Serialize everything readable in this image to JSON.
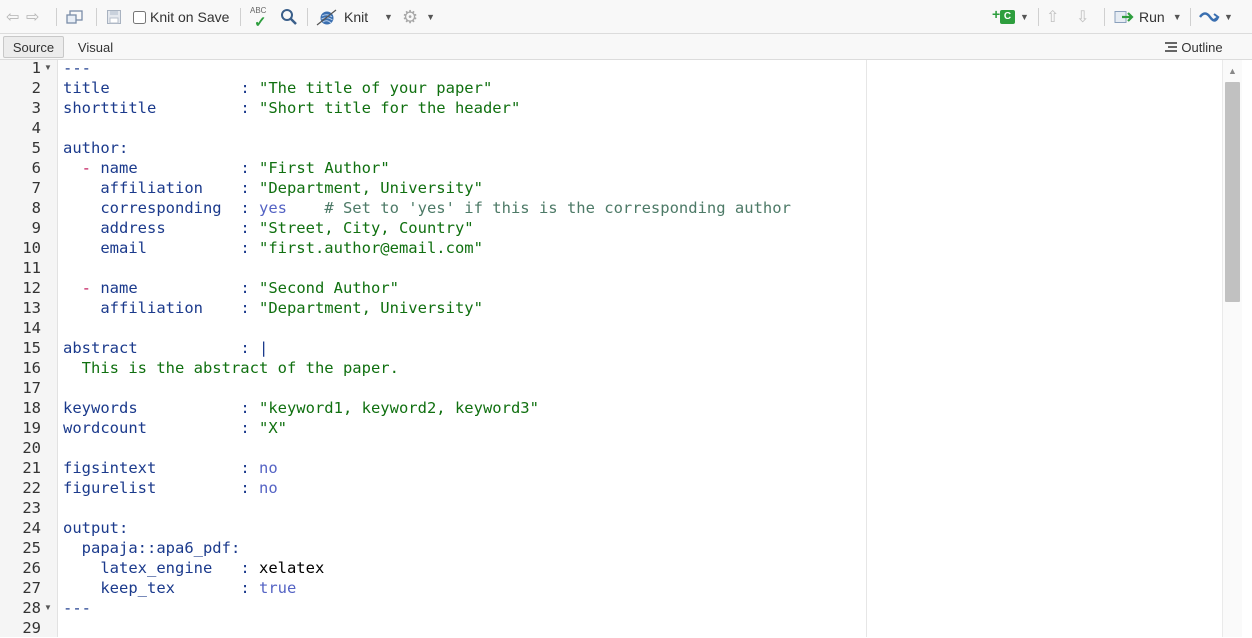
{
  "toolbar": {
    "knit_on_save_label": "Knit on Save",
    "knit_label": "Knit",
    "run_label": "Run",
    "spellcheck_badge": "ABC",
    "insert_chunk_badge": "C"
  },
  "modes": {
    "source_label": "Source",
    "visual_label": "Visual",
    "outline_label": "Outline"
  },
  "editor": {
    "line_numbers": [
      "1",
      "2",
      "3",
      "4",
      "5",
      "6",
      "7",
      "8",
      "9",
      "10",
      "11",
      "12",
      "13",
      "14",
      "15",
      "16",
      "17",
      "18",
      "19",
      "20",
      "21",
      "22",
      "23",
      "24",
      "25",
      "26",
      "27",
      "28",
      "29"
    ],
    "fold_lines": [
      1,
      28
    ],
    "lines": [
      [
        {
          "t": "---",
          "c": "k"
        }
      ],
      [
        {
          "t": "title              ",
          "c": "k"
        },
        {
          "t": ": ",
          "c": "k"
        },
        {
          "t": "\"The title of your paper\"",
          "c": "s"
        }
      ],
      [
        {
          "t": "shorttitle         ",
          "c": "k"
        },
        {
          "t": ": ",
          "c": "k"
        },
        {
          "t": "\"Short title for the header\"",
          "c": "s"
        }
      ],
      [],
      [
        {
          "t": "author:",
          "c": "k"
        }
      ],
      [
        {
          "t": "  ",
          "c": "k"
        },
        {
          "t": "-",
          "c": "d"
        },
        {
          "t": " name           ",
          "c": "k"
        },
        {
          "t": ": ",
          "c": "k"
        },
        {
          "t": "\"First Author\"",
          "c": "s"
        }
      ],
      [
        {
          "t": "    affiliation    ",
          "c": "k"
        },
        {
          "t": ": ",
          "c": "k"
        },
        {
          "t": "\"Department, University\"",
          "c": "s"
        }
      ],
      [
        {
          "t": "    corresponding  ",
          "c": "k"
        },
        {
          "t": ": ",
          "c": "k"
        },
        {
          "t": "yes",
          "c": "v"
        },
        {
          "t": "    ",
          "c": "k"
        },
        {
          "t": "# Set to 'yes' if this is the corresponding author",
          "c": "c"
        }
      ],
      [
        {
          "t": "    address        ",
          "c": "k"
        },
        {
          "t": ": ",
          "c": "k"
        },
        {
          "t": "\"Street, City, Country\"",
          "c": "s"
        }
      ],
      [
        {
          "t": "    email          ",
          "c": "k"
        },
        {
          "t": ": ",
          "c": "k"
        },
        {
          "t": "\"first.author@email.com\"",
          "c": "s"
        }
      ],
      [],
      [
        {
          "t": "  ",
          "c": "k"
        },
        {
          "t": "-",
          "c": "d"
        },
        {
          "t": " name           ",
          "c": "k"
        },
        {
          "t": ": ",
          "c": "k"
        },
        {
          "t": "\"Second Author\"",
          "c": "s"
        }
      ],
      [
        {
          "t": "    affiliation    ",
          "c": "k"
        },
        {
          "t": ": ",
          "c": "k"
        },
        {
          "t": "\"Department, University\"",
          "c": "s"
        }
      ],
      [],
      [
        {
          "t": "abstract           ",
          "c": "k"
        },
        {
          "t": ": |",
          "c": "k"
        }
      ],
      [
        {
          "t": "  This is the abstract of the paper.",
          "c": "s"
        }
      ],
      [],
      [
        {
          "t": "keywords           ",
          "c": "k"
        },
        {
          "t": ": ",
          "c": "k"
        },
        {
          "t": "\"keyword1, keyword2, keyword3\"",
          "c": "s"
        }
      ],
      [
        {
          "t": "wordcount          ",
          "c": "k"
        },
        {
          "t": ": ",
          "c": "k"
        },
        {
          "t": "\"X\"",
          "c": "s"
        }
      ],
      [],
      [
        {
          "t": "figsintext         ",
          "c": "k"
        },
        {
          "t": ": ",
          "c": "k"
        },
        {
          "t": "no",
          "c": "v"
        }
      ],
      [
        {
          "t": "figurelist         ",
          "c": "k"
        },
        {
          "t": ": ",
          "c": "k"
        },
        {
          "t": "no",
          "c": "v"
        }
      ],
      [],
      [
        {
          "t": "output:",
          "c": "k"
        }
      ],
      [
        {
          "t": "  papaja::apa6_pdf:",
          "c": "k"
        }
      ],
      [
        {
          "t": "    latex_engine   ",
          "c": "k"
        },
        {
          "t": ": ",
          "c": "k"
        },
        {
          "t": "xelatex",
          "c": "x"
        }
      ],
      [
        {
          "t": "    keep_tex       ",
          "c": "k"
        },
        {
          "t": ": ",
          "c": "k"
        },
        {
          "t": "true",
          "c": "v"
        }
      ],
      [
        {
          "t": "---",
          "c": "k"
        }
      ],
      []
    ]
  },
  "colors": {
    "key": "#1b3a8c",
    "string": "#107010",
    "value": "#5463c4",
    "comment": "#4d7a67",
    "dash": "#c2185b",
    "knit_blue": "#3a6fb0",
    "run_green": "#2e9e3e"
  }
}
